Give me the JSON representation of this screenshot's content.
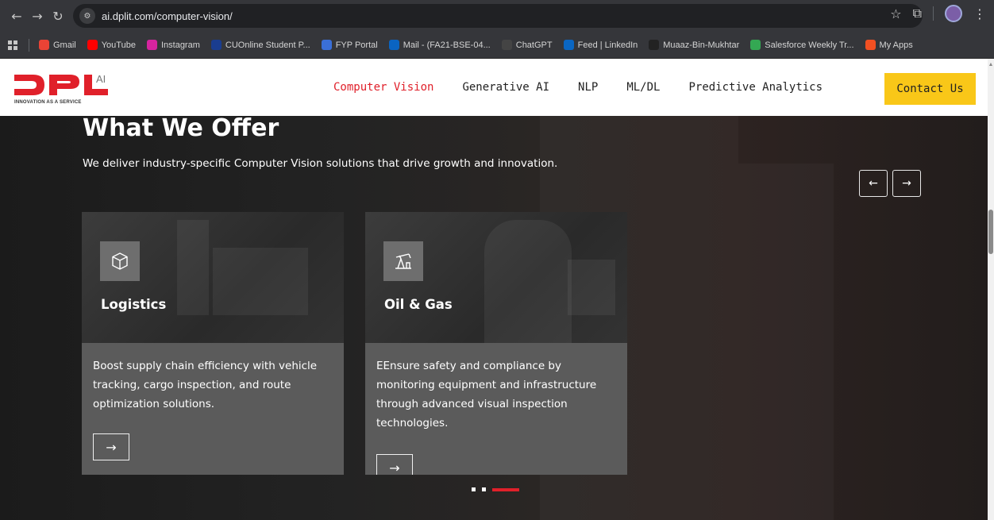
{
  "browser": {
    "url": "ai.dplit.com/computer-vision/",
    "bookmarks": [
      {
        "label": "Gmail",
        "color": "#ea4335"
      },
      {
        "label": "YouTube",
        "color": "#ff0000"
      },
      {
        "label": "Instagram",
        "color": "#d6249f"
      },
      {
        "label": "CUOnline Student P...",
        "color": "#1a3d8f"
      },
      {
        "label": "FYP Portal",
        "color": "#3a6fd8"
      },
      {
        "label": "Mail - (FA21-BSE-04...",
        "color": "#0a64c2"
      },
      {
        "label": "ChatGPT",
        "color": "#444444"
      },
      {
        "label": "Feed | LinkedIn",
        "color": "#0a66c2"
      },
      {
        "label": "Muaaz-Bin-Mukhtar",
        "color": "#222222"
      },
      {
        "label": "Salesforce Weekly Tr...",
        "color": "#34a853"
      },
      {
        "label": "My Apps",
        "color": "#f25022"
      }
    ]
  },
  "header": {
    "logo_text": "DPL",
    "logo_superscript": "AI",
    "logo_tagline": "INNOVATION AS A SERVICE",
    "nav": [
      "Computer Vision",
      "Generative AI",
      "NLP",
      "ML/DL",
      "Predictive Analytics"
    ],
    "active_nav": "Computer Vision",
    "contact_label": "Contact Us",
    "brand_color": "#e0202a",
    "accent_color": "#f9c718"
  },
  "hero": {
    "title": "What We Offer",
    "subtitle": "We deliver industry-specific Computer Vision solutions that drive growth and innovation.",
    "prev_label": "←",
    "next_label": "→"
  },
  "cards": [
    {
      "title": "Logistics",
      "icon": "box-icon",
      "description": "Boost supply chain efficiency with vehicle tracking, cargo inspection, and route optimization solutions.",
      "arrow_label": "→"
    },
    {
      "title": "Oil & Gas",
      "icon": "oil-pump-icon",
      "description": "EEnsure safety and compliance by monitoring equipment and infrastructure through advanced visual inspection technologies.",
      "arrow_label": "→"
    }
  ],
  "pagination": {
    "total": 3,
    "active_index": 2
  }
}
